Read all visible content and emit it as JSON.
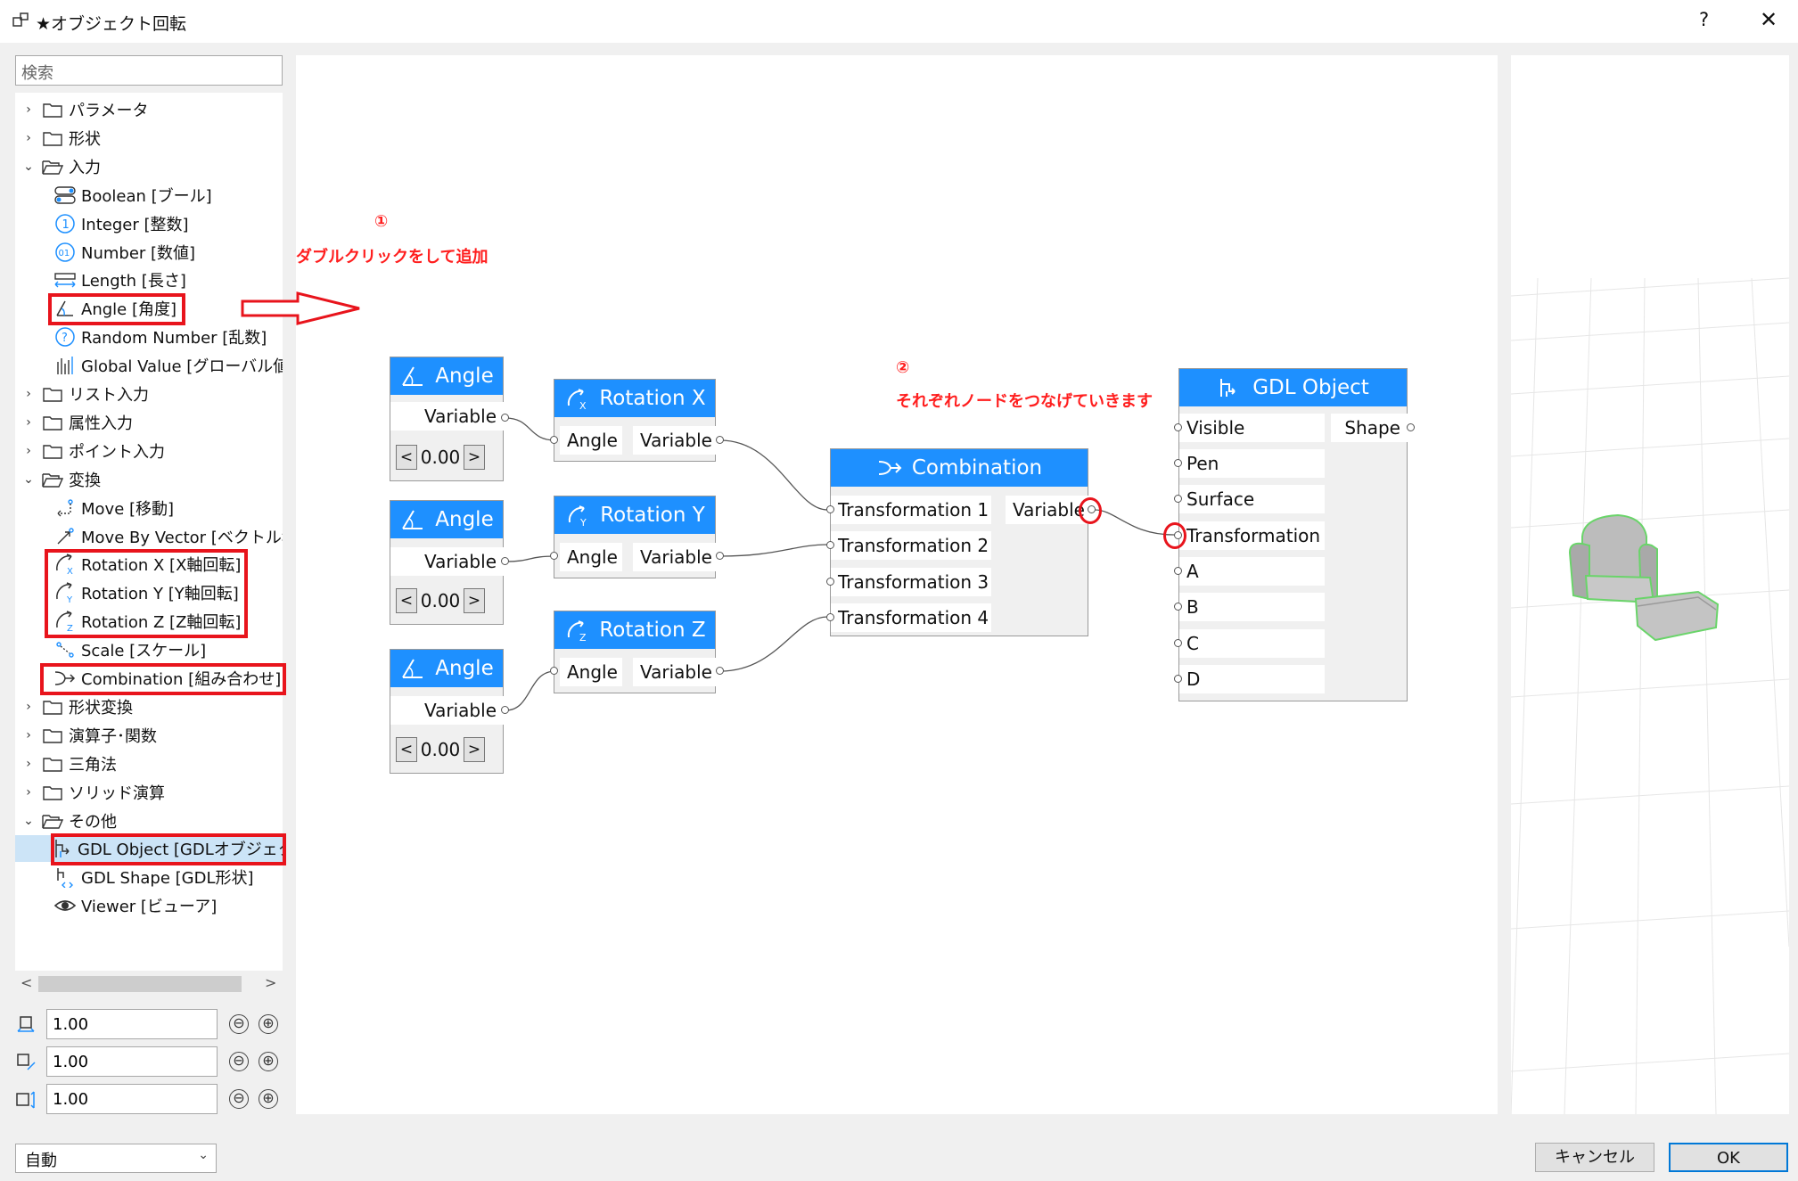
{
  "window": {
    "title": "★オブジェクト回転",
    "help_label": "?",
    "close_label": "✕"
  },
  "search": {
    "placeholder": "検索"
  },
  "tree": [
    {
      "label": "パラメータ",
      "level": 0,
      "arrow": "›",
      "icon": "folder-icon"
    },
    {
      "label": "形状",
      "level": 0,
      "arrow": "›",
      "icon": "folder-icon"
    },
    {
      "label": "入力",
      "level": 0,
      "arrow": "⌄",
      "icon": "folder-open-icon"
    },
    {
      "label": "Boolean [ブール]",
      "level": 1,
      "icon": "boolean-icon"
    },
    {
      "label": "Integer [整数]",
      "level": 1,
      "icon": "integer-icon"
    },
    {
      "label": "Number [数値]",
      "level": 1,
      "icon": "number-icon"
    },
    {
      "label": "Length [長さ]",
      "level": 1,
      "icon": "length-icon"
    },
    {
      "label": "Angle [角度]",
      "level": 1,
      "icon": "angle-icon"
    },
    {
      "label": "Random Number [乱数]",
      "level": 1,
      "icon": "random-icon"
    },
    {
      "label": "Global Value [グローバル値]",
      "level": 1,
      "icon": "global-value-icon"
    },
    {
      "label": "リスト入力",
      "level": 0,
      "arrow": "›",
      "icon": "folder-icon"
    },
    {
      "label": "属性入力",
      "level": 0,
      "arrow": "›",
      "icon": "folder-icon"
    },
    {
      "label": "ポイント入力",
      "level": 0,
      "arrow": "›",
      "icon": "folder-icon"
    },
    {
      "label": "変換",
      "level": 0,
      "arrow": "⌄",
      "icon": "folder-open-icon"
    },
    {
      "label": "Move [移動]",
      "level": 1,
      "icon": "move-icon"
    },
    {
      "label": "Move By Vector [ベクトル移",
      "level": 1,
      "icon": "move-vector-icon"
    },
    {
      "label": "Rotation X [X軸回転]",
      "level": 1,
      "icon": "rotation-x-icon"
    },
    {
      "label": "Rotation Y [Y軸回転]",
      "level": 1,
      "icon": "rotation-y-icon"
    },
    {
      "label": "Rotation Z [Z軸回転]",
      "level": 1,
      "icon": "rotation-z-icon"
    },
    {
      "label": "Scale [スケール]",
      "level": 1,
      "icon": "scale-icon"
    },
    {
      "label": "Combination [組み合わせ]",
      "level": 1,
      "icon": "combination-icon"
    },
    {
      "label": "形状変換",
      "level": 0,
      "arrow": "›",
      "icon": "folder-icon"
    },
    {
      "label": "演算子･関数",
      "level": 0,
      "arrow": "›",
      "icon": "folder-icon"
    },
    {
      "label": "三角法",
      "level": 0,
      "arrow": "›",
      "icon": "folder-icon"
    },
    {
      "label": "ソリッド演算",
      "level": 0,
      "arrow": "›",
      "icon": "folder-icon"
    },
    {
      "label": "その他",
      "level": 0,
      "arrow": "⌄",
      "icon": "folder-open-icon"
    },
    {
      "label": "GDL Object [GDLオブジェクト",
      "level": 1,
      "icon": "gdl-object-icon",
      "selected": true
    },
    {
      "label": "GDL Shape [GDL形状]",
      "level": 1,
      "icon": "gdl-shape-icon"
    },
    {
      "label": "Viewer [ビューア]",
      "level": 1,
      "icon": "eye-icon"
    }
  ],
  "scale_inputs": [
    {
      "value": "1.00",
      "icon": "scale-x-icon"
    },
    {
      "value": "1.00",
      "icon": "scale-y-icon"
    },
    {
      "value": "1.00",
      "icon": "scale-z-icon"
    }
  ],
  "stepper_minus": "⊖",
  "stepper_plus": "⊕",
  "scroll": {
    "left": "<",
    "right": ">"
  },
  "mode_select": {
    "value": "自動"
  },
  "buttons": {
    "cancel": "キャンセル",
    "ok": "OK"
  },
  "nodes": {
    "angle_1": {
      "title": "Angle",
      "output": "Variable",
      "value": "0.00",
      "dec": "<",
      "inc": ">"
    },
    "angle_2": {
      "title": "Angle",
      "output": "Variable",
      "value": "0.00",
      "dec": "<",
      "inc": ">"
    },
    "angle_3": {
      "title": "Angle",
      "output": "Variable",
      "value": "0.00",
      "dec": "<",
      "inc": ">"
    },
    "rotation_x": {
      "title": "Rotation X",
      "input": "Angle",
      "output": "Variable"
    },
    "rotation_y": {
      "title": "Rotation Y",
      "input": "Angle",
      "output": "Variable"
    },
    "rotation_z": {
      "title": "Rotation Z",
      "input": "Angle",
      "output": "Variable"
    },
    "combination": {
      "title": "Combination",
      "inputs": [
        "Transformation 1",
        "Transformation 2",
        "Transformation 3",
        "Transformation 4"
      ],
      "output": "Variable"
    },
    "gdl_object": {
      "title": "GDL Object",
      "inputs": [
        "Visible",
        "Pen",
        "Surface",
        "Transformation",
        "A",
        "B",
        "C",
        "D"
      ],
      "output": "Shape"
    }
  },
  "annotations": {
    "step1_marker": "①",
    "step1_text": "ダブルクリックをして追加",
    "step2_marker": "②",
    "step2_text": "それぞれノードをつなげていきます"
  },
  "colors": {
    "node_header": "#1e90ff",
    "annotation": "#ff1e1e",
    "selection": "#cce4f7"
  }
}
